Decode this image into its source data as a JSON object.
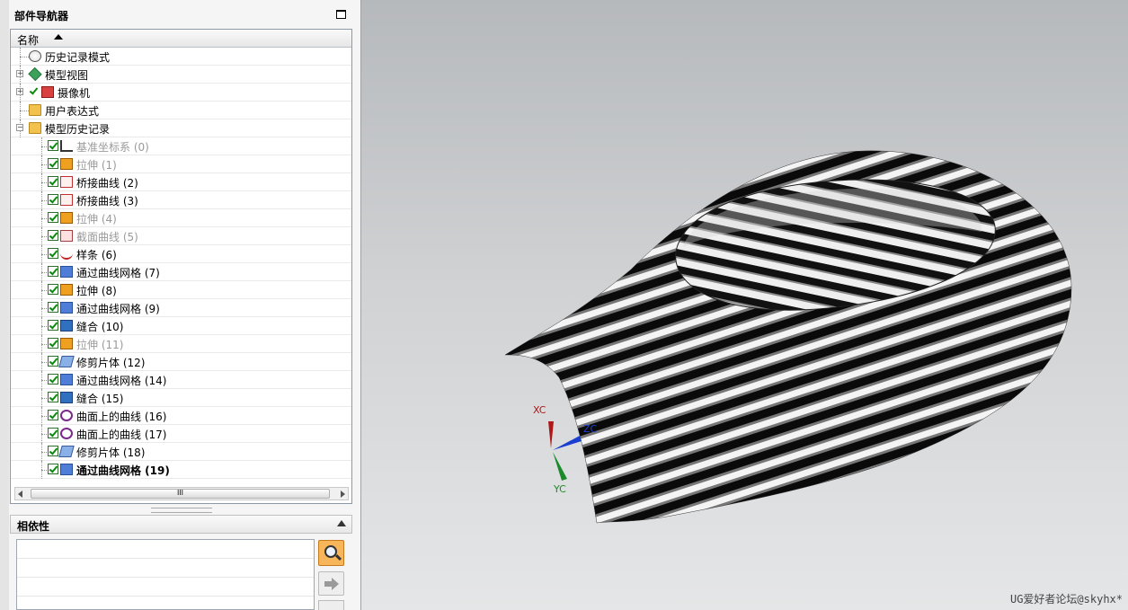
{
  "navigator": {
    "title": "部件导航器",
    "column_name": "名称"
  },
  "tree": [
    {
      "label": "历史记录模式",
      "icon": "clock-icon",
      "level": 0
    },
    {
      "label": "模型视图",
      "icon": "model-view-icon",
      "level": 0,
      "expander": "+"
    },
    {
      "label": "摄像机",
      "icon": "camera-icon",
      "level": 0,
      "expander": "+",
      "checked": true
    },
    {
      "label": "用户表达式",
      "icon": "folder-icon",
      "level": 0
    },
    {
      "label": "模型历史记录",
      "icon": "folder-open-icon",
      "level": 0,
      "expander": "-"
    },
    {
      "label": "基准坐标系 (0)",
      "icon": "datum-csys-icon",
      "level": 1,
      "checked": true,
      "dim": true
    },
    {
      "label": "拉伸 (1)",
      "icon": "extrude-icon",
      "level": 1,
      "checked": true,
      "dim": true
    },
    {
      "label": "桥接曲线 (2)",
      "icon": "bridge-curve-icon",
      "level": 1,
      "checked": true
    },
    {
      "label": "桥接曲线 (3)",
      "icon": "bridge-curve-icon",
      "level": 1,
      "checked": true
    },
    {
      "label": "拉伸 (4)",
      "icon": "extrude-icon",
      "level": 1,
      "checked": true,
      "dim": true
    },
    {
      "label": "截面曲线 (5)",
      "icon": "section-curve-icon",
      "level": 1,
      "checked": true,
      "dim": true
    },
    {
      "label": "样条 (6)",
      "icon": "spline-icon",
      "level": 1,
      "checked": true
    },
    {
      "label": "通过曲线网格 (7)",
      "icon": "curve-mesh-icon",
      "level": 1,
      "checked": true
    },
    {
      "label": "拉伸 (8)",
      "icon": "extrude-icon",
      "level": 1,
      "checked": true
    },
    {
      "label": "通过曲线网格 (9)",
      "icon": "curve-mesh-icon",
      "level": 1,
      "checked": true
    },
    {
      "label": "缝合 (10)",
      "icon": "sew-icon",
      "level": 1,
      "checked": true
    },
    {
      "label": "拉伸 (11)",
      "icon": "extrude-icon",
      "level": 1,
      "checked": true,
      "dim": true
    },
    {
      "label": "修剪片体 (12)",
      "icon": "trim-sheet-icon",
      "level": 1,
      "checked": true
    },
    {
      "label": "通过曲线网格 (14)",
      "icon": "curve-mesh-icon",
      "level": 1,
      "checked": true
    },
    {
      "label": "缝合 (15)",
      "icon": "sew-icon",
      "level": 1,
      "checked": true
    },
    {
      "label": "曲面上的曲线 (16)",
      "icon": "curve-on-surface-icon",
      "level": 1,
      "checked": true
    },
    {
      "label": "曲面上的曲线 (17)",
      "icon": "curve-on-surface-icon",
      "level": 1,
      "checked": true
    },
    {
      "label": "修剪片体 (18)",
      "icon": "trim-sheet-icon",
      "level": 1,
      "checked": true
    },
    {
      "label": "通过曲线网格 (19)",
      "icon": "curve-mesh-icon",
      "level": 1,
      "checked": true,
      "bold": true
    }
  ],
  "scrollbar": {
    "grip": "III"
  },
  "dependencies": {
    "title": "相依性"
  },
  "viewport": {
    "axes": {
      "x": "XC",
      "y": "YC",
      "z": "ZC"
    },
    "watermark": "UG爱好者论坛@skyhx*"
  },
  "colors": {
    "x_axis": "#b01818",
    "y_axis": "#1a8a2a",
    "z_axis": "#1a3fd0"
  }
}
